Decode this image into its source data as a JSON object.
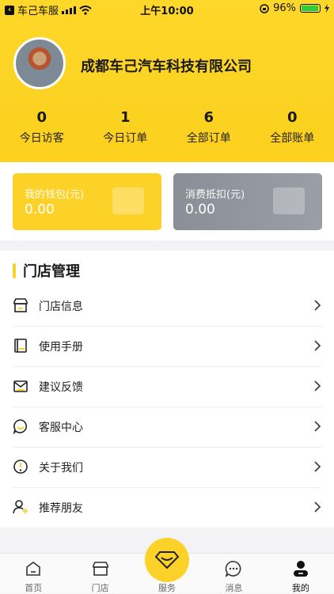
{
  "status_bar": {
    "carrier": "车己车服",
    "time": "上午10:00",
    "battery": "96%",
    "battery_level": 0.96
  },
  "profile": {
    "company_name": "成都车己汽车科技有限公司"
  },
  "stats": [
    {
      "value": "0",
      "label": "今日访客"
    },
    {
      "value": "1",
      "label": "今日订单"
    },
    {
      "value": "6",
      "label": "全部订单"
    },
    {
      "value": "0",
      "label": "全部账单"
    }
  ],
  "cards": {
    "wallet": {
      "title": "我的钱包(元)",
      "amount": "0.00"
    },
    "deduction": {
      "title": "消费抵扣(元)",
      "amount": "0.00"
    }
  },
  "section": {
    "title": "门店管理",
    "items": [
      {
        "label": "门店信息",
        "icon": "store-icon"
      },
      {
        "label": "使用手册",
        "icon": "book-icon"
      },
      {
        "label": "建议反馈",
        "icon": "mail-icon"
      },
      {
        "label": "客服中心",
        "icon": "chat-smile-icon"
      },
      {
        "label": "关于我们",
        "icon": "info-icon"
      },
      {
        "label": "推荐朋友",
        "icon": "user-add-icon"
      }
    ]
  },
  "tabbar": [
    {
      "label": "首页",
      "icon": "home-icon"
    },
    {
      "label": "门店",
      "icon": "store-icon"
    },
    {
      "label": "服务",
      "icon": "diamond-icon"
    },
    {
      "label": "消息",
      "icon": "message-icon"
    },
    {
      "label": "我的",
      "icon": "user-icon"
    }
  ],
  "colors": {
    "accent": "#fcd128",
    "grey_card": "#8e929b"
  }
}
